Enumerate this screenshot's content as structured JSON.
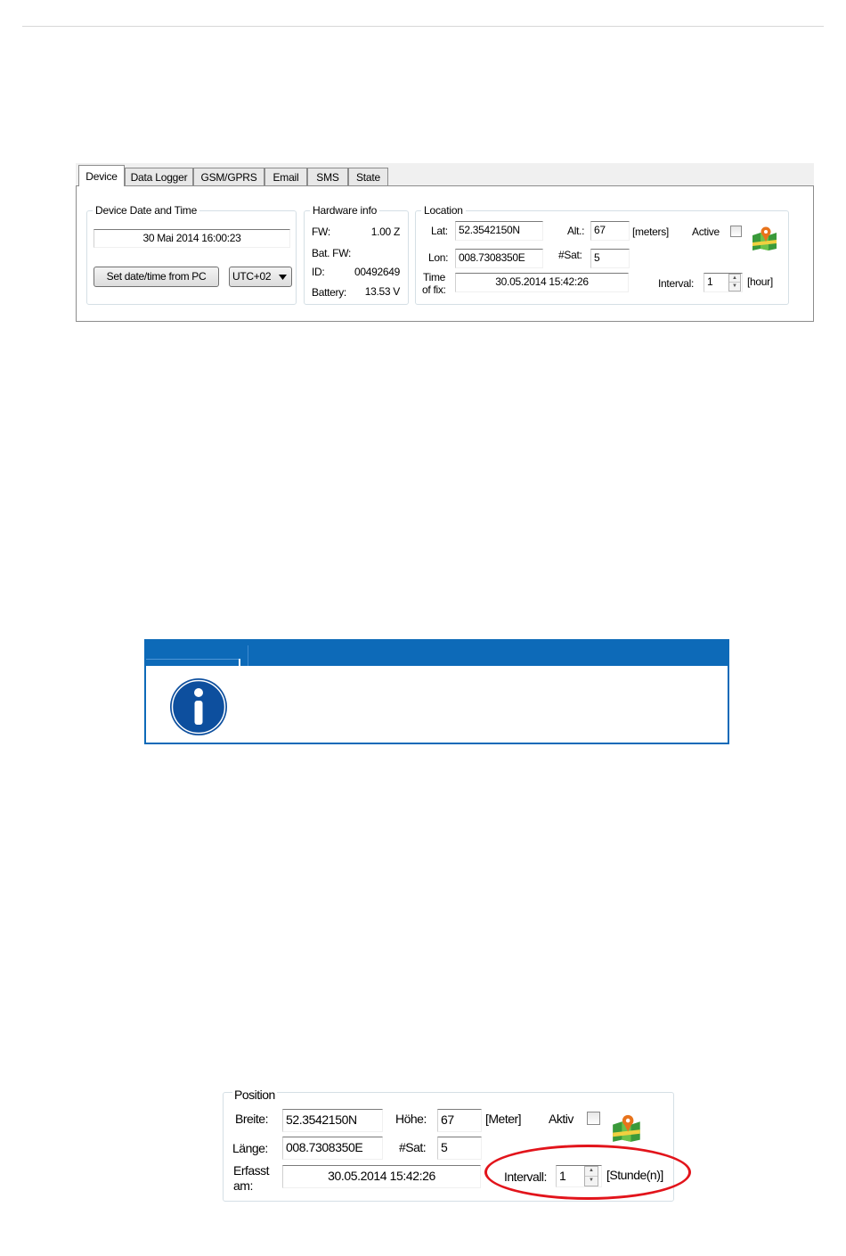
{
  "device_dialog": {
    "tabs": [
      "Device",
      "Data Logger",
      "GSM/GPRS",
      "Email",
      "SMS",
      "State"
    ],
    "active_tab": "Device",
    "date_time_group": {
      "title": "Device Date and Time",
      "value": "30 Mai 2014   16:00:23",
      "set_button": "Set date/time from PC",
      "timezone": "UTC+02"
    },
    "hardware_group": {
      "title": "Hardware info",
      "fw_label": "FW:",
      "fw_value": "1.00 Z",
      "batfw_label": "Bat. FW:",
      "batfw_value": "",
      "id_label": "ID:",
      "id_value": "00492649",
      "battery_label": "Battery:",
      "battery_value": "13.53 V"
    },
    "location_group": {
      "title": "Location",
      "lat_label": "Lat:",
      "lat_value": "52.3542150N",
      "lon_label": "Lon:",
      "lon_value": "008.7308350E",
      "time_label_1": "Time",
      "time_label_2": "of fix:",
      "time_value": "30.05.2014 15:42:26",
      "alt_label": "Alt.:",
      "alt_value": "67",
      "alt_unit": "[meters]",
      "sat_label": "#Sat:",
      "sat_value": "5",
      "active_label": "Active",
      "active_checked": false,
      "interval_label": "Interval:",
      "interval_value": "1",
      "interval_unit": "[hour]",
      "map_icon": "map-pin-icon"
    }
  },
  "info_box": {
    "icon": "info-icon",
    "color": "#0d6ab8"
  },
  "position_dialog": {
    "title": "Position",
    "breite_label": "Breite:",
    "breite_value": "52.3542150N",
    "laenge_label": "Länge:",
    "laenge_value": "008.7308350E",
    "erfasst_label_1": "Erfasst",
    "erfasst_label_2": "am:",
    "erfasst_value": "30.05.2014 15:42:26",
    "hoehe_label": "Höhe:",
    "hoehe_value": "67",
    "hoehe_unit": "[Meter]",
    "sat_label": "#Sat:",
    "sat_value": "5",
    "aktiv_label": "Aktiv",
    "aktiv_checked": false,
    "intervall_label": "Intervall:",
    "intervall_value": "1",
    "intervall_unit": "[Stunde(n)]",
    "highlight_color": "#e2141b"
  }
}
